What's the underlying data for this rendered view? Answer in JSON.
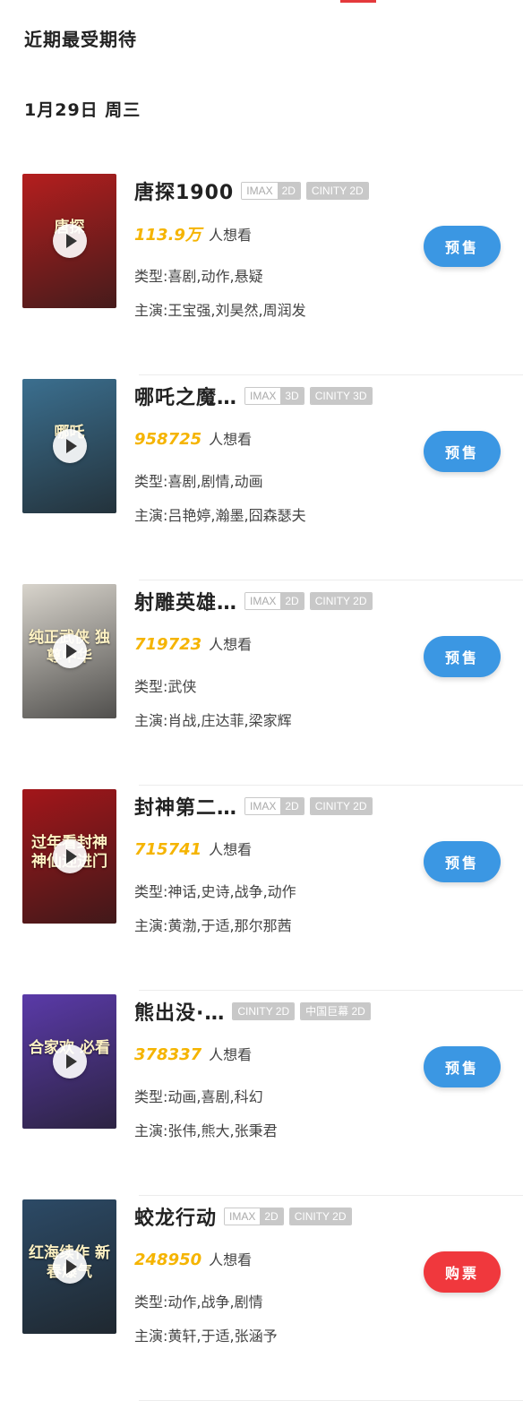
{
  "header": {
    "section_title": "近期最受期待",
    "date_title": "1月29日 周三"
  },
  "colors": {
    "presale_button": "#3b97e3",
    "buy_button": "#f0383d",
    "want_count": "#f5b400",
    "tag_gray": "#c8c8c8"
  },
  "movies": [
    {
      "title": "唐探1900",
      "tags": [
        {
          "a": "IMAX",
          "b": "2D"
        },
        {
          "a": "CINITY 2D",
          "b": ""
        }
      ],
      "want_count": "113.9万",
      "want_label": "人想看",
      "genre": "类型:喜剧,动作,悬疑",
      "cast": "主演:王宝强,刘昊然,周润发",
      "button": "预售",
      "poster_text": "唐探",
      "poster_color": "#b41e1e",
      "play_icon": "play-icon"
    },
    {
      "title": "哪吒之魔…",
      "tags": [
        {
          "a": "IMAX",
          "b": "3D"
        },
        {
          "a": "CINITY 3D",
          "b": ""
        }
      ],
      "want_count": "958725",
      "want_label": "人想看",
      "genre": "类型:喜剧,剧情,动画",
      "cast": "主演:吕艳婷,瀚墨,囧森瑟夫",
      "button": "预售",
      "poster_text": "哪吒",
      "poster_color": "#3b6f8f",
      "play_icon": "play-icon"
    },
    {
      "title": "射雕英雄…",
      "tags": [
        {
          "a": "IMAX",
          "b": "2D"
        },
        {
          "a": "CINITY 2D",
          "b": ""
        }
      ],
      "want_count": "719723",
      "want_label": "人想看",
      "genre": "类型:武侠",
      "cast": "主演:肖战,庄达菲,梁家辉",
      "button": "预售",
      "poster_text": "纯正武侠 独尊中华",
      "poster_color": "#d8d4cc",
      "play_icon": "play-icon"
    },
    {
      "title": "封神第二…",
      "tags": [
        {
          "a": "IMAX",
          "b": "2D"
        },
        {
          "a": "CINITY 2D",
          "b": ""
        }
      ],
      "want_count": "715741",
      "want_label": "人想看",
      "genre": "类型:神话,史诗,战争,动作",
      "cast": "主演:黄渤,于适,那尔那茜",
      "button": "预售",
      "poster_text": "过年看封神 神仙迎进门",
      "poster_color": "#a3161a",
      "play_icon": "play-icon"
    },
    {
      "title": "熊出没·…",
      "tags": [
        {
          "a": "CINITY 2D",
          "b": ""
        },
        {
          "a": "中国巨幕 2D",
          "b": ""
        }
      ],
      "want_count": "378337",
      "want_label": "人想看",
      "genre": "类型:动画,喜剧,科幻",
      "cast": "主演:张伟,熊大,张秉君",
      "button": "预售",
      "poster_text": "合家欢 必看",
      "poster_color": "#5a3aa8",
      "play_icon": "play-icon"
    },
    {
      "title": "蛟龙行动",
      "tags": [
        {
          "a": "IMAX",
          "b": "2D"
        },
        {
          "a": "CINITY 2D",
          "b": ""
        }
      ],
      "want_count": "248950",
      "want_label": "人想看",
      "genre": "类型:动作,战争,剧情",
      "cast": "主演:黄轩,于适,张涵予",
      "button": "购票",
      "poster_text": "红海续作 新春爆气",
      "poster_color": "#2c4a66",
      "play_icon": "play-icon"
    }
  ]
}
